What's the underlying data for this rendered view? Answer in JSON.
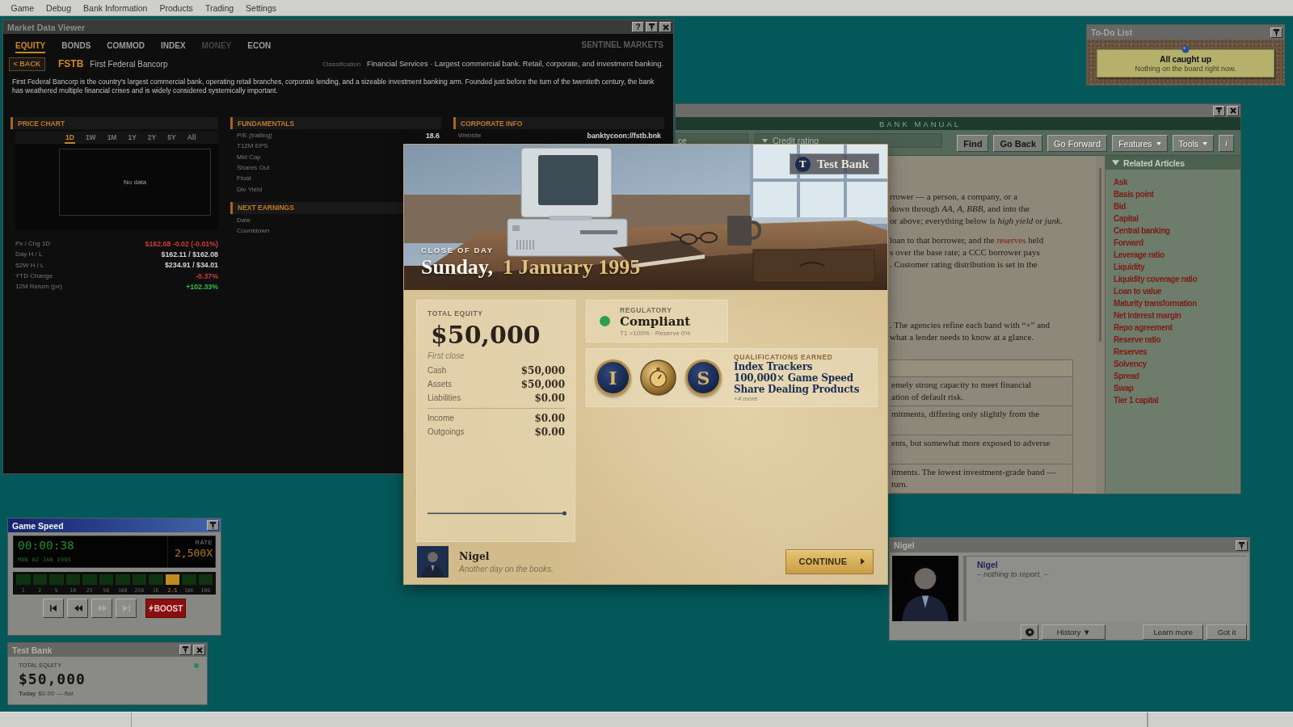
{
  "menu_bar": {
    "items": [
      "Game",
      "Debug",
      "Bank Information",
      "Products",
      "Trading",
      "Settings"
    ]
  },
  "market_data_viewer": {
    "title": "Market Data Viewer",
    "help_label": "?",
    "tabs": [
      {
        "label": "EQUITY",
        "selected": true,
        "disabled": false
      },
      {
        "label": "BONDS",
        "selected": false,
        "disabled": false
      },
      {
        "label": "COMMOD",
        "selected": false,
        "disabled": false
      },
      {
        "label": "INDEX",
        "selected": false,
        "disabled": false
      },
      {
        "label": "MONEY",
        "selected": false,
        "disabled": true
      },
      {
        "label": "ECON",
        "selected": false,
        "disabled": false
      }
    ],
    "provider": "SENTINEL MARKETS",
    "back_label": "< BACK",
    "ticker": "FSTB",
    "company": "First Federal Bancorp",
    "classification_label": "Classification",
    "classification": "Financial Services · Largest commercial bank. Retail, corporate, and investment banking.",
    "description": "First Federal Bancorp is the country's largest commercial bank, operating retail branches, corporate lending, and a sizeable investment banking arm. Founded just before the turn of the twentieth century, the bank has weathered multiple financial crises and is widely considered systemically important.",
    "price_chart": {
      "title": "PRICE CHART",
      "ranges": [
        {
          "label": "1D",
          "selected": true
        },
        {
          "label": "1W",
          "selected": false
        },
        {
          "label": "1M",
          "selected": false
        },
        {
          "label": "1Y",
          "selected": false
        },
        {
          "label": "2Y",
          "selected": false
        },
        {
          "label": "5Y",
          "selected": false
        },
        {
          "label": "All",
          "selected": false
        }
      ],
      "empty_text": "No data",
      "stats": [
        {
          "label": "Px / Chg 1D",
          "value": "$162.08 -0.02 (-0.01%)",
          "color": "#d43a3a"
        },
        {
          "label": "Day H / L",
          "value": "$162.11 / $162.08",
          "color": "#d6d6d6"
        },
        {
          "label": "52W H / L",
          "value": "$234.91 / $34.01",
          "color": "#d6d6d6"
        },
        {
          "label": "YTD Change",
          "value": "-0.37%",
          "color": "#d43a3a"
        },
        {
          "label": "12M Return (px)",
          "value": "+102.33%",
          "color": "#2fbe47"
        }
      ]
    },
    "fundamentals": {
      "title": "FUNDAMENTALS",
      "rows": [
        {
          "label": "P/E (trailing)",
          "value": "18.6"
        },
        {
          "label": "T12M EPS"
        },
        {
          "label": "Mkt Cap"
        },
        {
          "label": "Shares Out"
        },
        {
          "label": "Float"
        },
        {
          "label": "Div Yield"
        }
      ]
    },
    "next_earnings": {
      "title": "NEXT EARNINGS",
      "rows": [
        {
          "label": "Date"
        },
        {
          "label": "Countdown"
        }
      ]
    },
    "corporate_info": {
      "title": "CORPORATE INFO",
      "rows": [
        {
          "label": "Website",
          "value": "banktycoon://fstb.bnk"
        }
      ]
    }
  },
  "bank_manual": {
    "title": "BANK MANUAL",
    "search_value": "ce",
    "topic": "Credit rating",
    "buttons": [
      {
        "label": "Find",
        "kind": "action",
        "disabled": false
      },
      {
        "label": "Go Back",
        "kind": "action",
        "disabled": false
      },
      {
        "label": "Go Forward",
        "kind": "action",
        "disabled": true
      },
      {
        "label": "Features",
        "kind": "menu",
        "disabled": true
      },
      {
        "label": "Tools",
        "kind": "menu",
        "disabled": true
      },
      {
        "label": "i",
        "kind": "info",
        "disabled": true
      }
    ],
    "paragraphs": [
      {
        "segments": [
          {
            "text": "rrower — a person, a company, or a\ndown through *AA*, *A*, *BBB*, and into the\nor above; everything below is *high yield* or *junk*.",
            "link": false
          }
        ]
      },
      {
        "segments": [
          {
            "text": "loan to that borrower, and the ",
            "link": false
          },
          {
            "text": "reserves",
            "link": true
          },
          {
            "text": " held\ns over the base rate; a CCC borrower pays\n. Customer rating distribution is set in the",
            "link": false
          }
        ]
      },
      {
        "segments": [
          {
            "text": ". The agencies refine each band with “+” and\nwhat a lender needs to know at a glance.",
            "link": false
          }
        ]
      }
    ],
    "table_rows": [
      "emely strong capacity to meet financial\nation of default risk.",
      "mitments, differing only slightly from the",
      "ents, but somewhat more exposed to adverse",
      "itments. The lowest investment-grade band —\nturn."
    ],
    "related_title": "Related Articles",
    "related": [
      "Ask",
      "Basis point",
      "Bid",
      "Capital",
      "Central banking",
      "Forward",
      "Leverage ratio",
      "Liquidity",
      "Liquidity coverage ratio",
      "Loan to value",
      "Maturity transformation",
      "Net interest margin",
      "Repo agreement",
      "Reserve ratio",
      "Reserves",
      "Solvency",
      "Spread",
      "Swap",
      "Tier 1 capital"
    ]
  },
  "todo": {
    "title": "To-Do List",
    "note_title": "All caught up",
    "note_text": "Nothing on the board right now."
  },
  "game_speed": {
    "title": "Game Speed",
    "clock": "00:00:38",
    "date": "MON 02 JAN 1995",
    "rate_label": "RATE",
    "rate": "2,500X",
    "steps": [
      {
        "label": "1",
        "selected": false
      },
      {
        "label": "2",
        "selected": false
      },
      {
        "label": "5",
        "selected": false
      },
      {
        "label": "10",
        "selected": false
      },
      {
        "label": "25",
        "selected": false
      },
      {
        "label": "50",
        "selected": false
      },
      {
        "label": "100",
        "selected": false
      },
      {
        "label": "250",
        "selected": false
      },
      {
        "label": "1K",
        "selected": false
      },
      {
        "label": "2.5",
        "selected": true
      },
      {
        "label": "10K",
        "selected": false
      },
      {
        "label": "100",
        "selected": false
      }
    ],
    "controls": [
      {
        "kind": "skip-back",
        "disabled": false
      },
      {
        "kind": "rewind",
        "disabled": false
      },
      {
        "kind": "fast-forward",
        "disabled": true
      },
      {
        "kind": "skip-forward",
        "disabled": true
      }
    ],
    "boost_label": "BOOST"
  },
  "bank_summary": {
    "title": "Test Bank",
    "equity_label": "TOTAL EQUITY",
    "equity": "$50,000",
    "color": "#2c8a4c",
    "today_label": "Today",
    "today_change": "$0.00 — flat"
  },
  "advisor_window": {
    "title": "Nigel",
    "speaker": "Nigel",
    "message": "– nothing to report. –",
    "buttons": [
      {
        "kind": "settings"
      },
      {
        "kind": "menu",
        "label": "History ▼"
      },
      {
        "kind": "plain",
        "label": "Learn more"
      },
      {
        "kind": "plain",
        "label": "Got it"
      }
    ]
  },
  "day_summary": {
    "eyebrow": "CLOSE OF DAY",
    "weekday": "Sunday,",
    "date": "1 January 1995",
    "bank_initial": "T",
    "bank_name": "Test Bank",
    "equity_label": "TOTAL EQUITY",
    "equity": "$50,000",
    "equity_note": "First close",
    "balances": [
      {
        "label": "Cash",
        "value": "$50,000"
      },
      {
        "label": "Assets",
        "value": "$50,000"
      },
      {
        "label": "Liabilities",
        "value": "$0.00"
      }
    ],
    "flows": [
      {
        "label": "Income",
        "value": "$0.00"
      },
      {
        "label": "Outgoings",
        "value": "$0.00"
      }
    ],
    "regulatory": {
      "label": "REGULATORY",
      "color": "#2f9d4e",
      "headline": "Compliant",
      "detail": "T1 >100% · Reserve 0%"
    },
    "qualifications": {
      "label": "QUALIFICATIONS EARNED",
      "badges": [
        {
          "kind": "letter",
          "letter": "I"
        },
        {
          "kind": "stopwatch"
        },
        {
          "kind": "letter",
          "letter": "S"
        }
      ],
      "items": [
        "Index Trackers",
        "100,000× Game Speed",
        "Share Dealing Products"
      ],
      "more": "+4 more"
    },
    "advisor_name": "Nigel",
    "advisor_remark": "Another day on the books.",
    "continue_label": "CONTINUE"
  }
}
